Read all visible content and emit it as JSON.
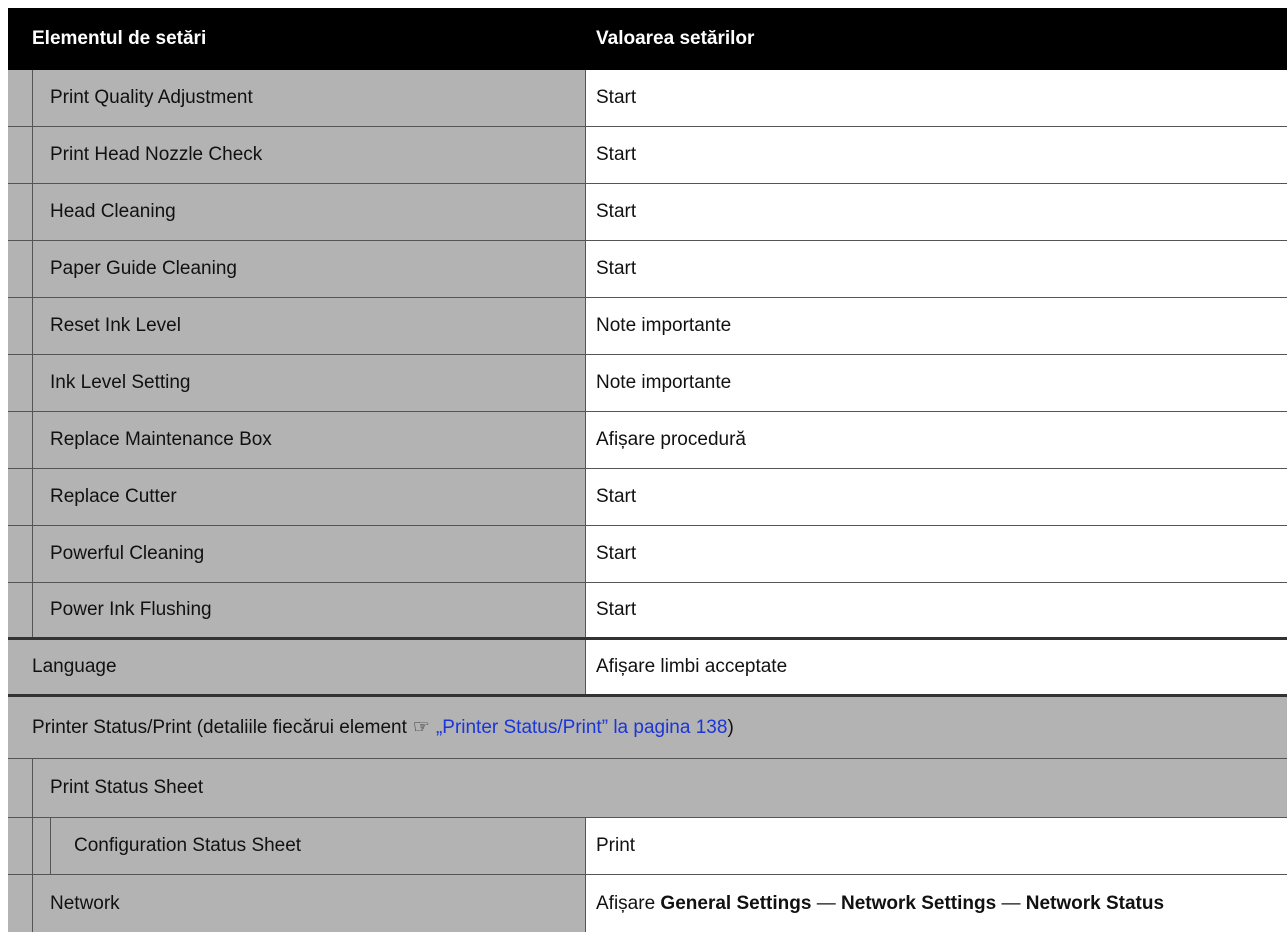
{
  "header": {
    "col1": "Elementul de setări",
    "col2": "Valoarea setărilor"
  },
  "maintenance_rows": [
    {
      "item": "Print Quality Adjustment",
      "value": "Start"
    },
    {
      "item": "Print Head Nozzle Check",
      "value": "Start"
    },
    {
      "item": "Head Cleaning",
      "value": "Start"
    },
    {
      "item": "Paper Guide Cleaning",
      "value": "Start"
    },
    {
      "item": "Reset Ink Level",
      "value": "Note importante"
    },
    {
      "item": "Ink Level Setting",
      "value": "Note importante"
    },
    {
      "item": "Replace Maintenance Box",
      "value": "Afișare procedură"
    },
    {
      "item": "Replace Cutter",
      "value": "Start"
    },
    {
      "item": "Powerful Cleaning",
      "value": "Start"
    },
    {
      "item": "Power Ink Flushing",
      "value": "Start"
    }
  ],
  "language_row": {
    "item": "Language",
    "value": "Afișare limbi acceptate"
  },
  "printer_status": {
    "prefix": "Printer Status/Print (detaliile fiecărui element",
    "ref_icon": "reference-hand-icon",
    "ref_glyph": "☞",
    "link": "„Printer Status/Print” la pagina 138",
    "suffix": ")"
  },
  "print_status_sheet": {
    "item": "Print Status Sheet"
  },
  "configuration_row": {
    "item": "Configuration Status Sheet",
    "value": "Print"
  },
  "network_row": {
    "item": "Network",
    "value_prefix": "Afișare",
    "p1": "General Settings",
    "sep1": "—",
    "p2": "Network Settings",
    "sep2": "—",
    "p3": "Network Status"
  }
}
